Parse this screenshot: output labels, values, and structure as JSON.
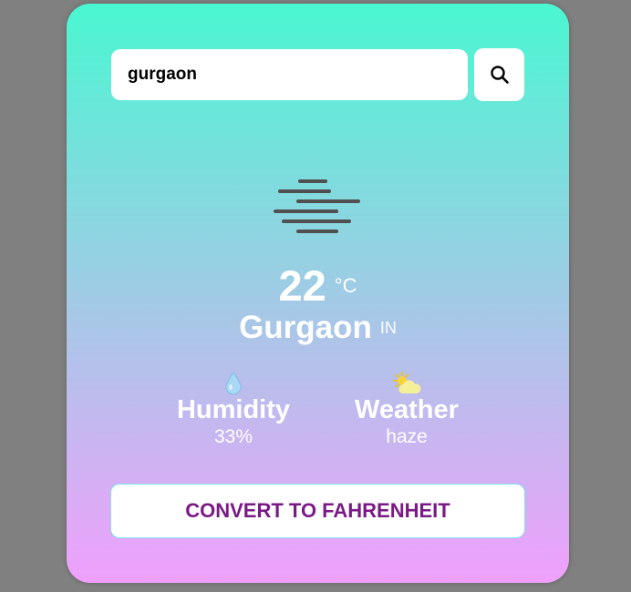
{
  "search": {
    "value": "gurgaon",
    "icon": "search-icon"
  },
  "current": {
    "condition_icon": "haze-icon",
    "temperature": "22",
    "unit": "°C",
    "city": "Gurgaon",
    "country": "IN"
  },
  "stats": {
    "humidity": {
      "icon": "water-drop-icon",
      "label": "Humidity",
      "value": "33%"
    },
    "weather": {
      "icon": "partly-sunny-icon",
      "label": "Weather",
      "value": "haze"
    }
  },
  "convert_button": {
    "label": "CONVERT TO FAHRENHEIT"
  },
  "colors": {
    "gradient_top": "#4af7d2",
    "gradient_bottom": "#f0a0fc",
    "button_text": "#7a1a86",
    "page_background": "#808080"
  }
}
